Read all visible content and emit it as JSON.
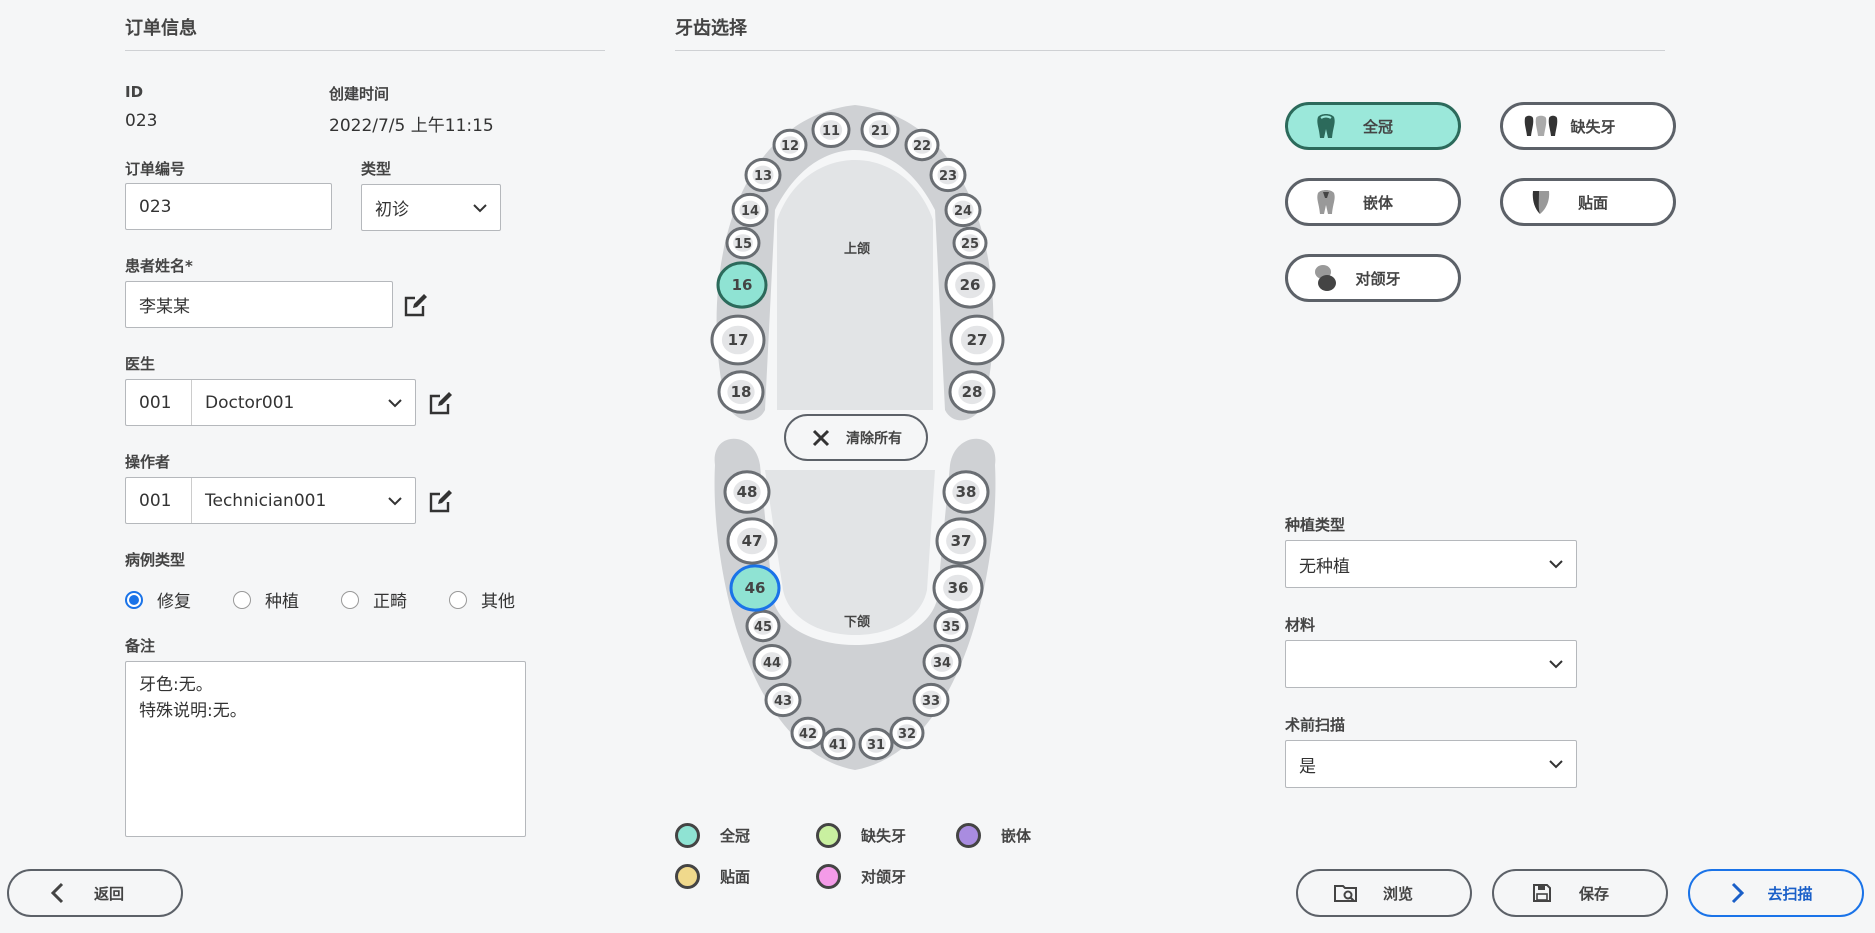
{
  "order": {
    "title": "订单信息",
    "id_label": "ID",
    "id_value": "023",
    "created_label": "创建时间",
    "created_value": "2022/7/5 上午11:15",
    "order_no_label": "订单编号",
    "order_no_value": "023",
    "type_label": "类型",
    "type_value": "初诊",
    "patient_label": "患者姓名*",
    "patient_value": "李某某",
    "doctor_label": "医生",
    "doctor_code": "001",
    "doctor_name": "Doctor001",
    "operator_label": "操作者",
    "operator_code": "001",
    "operator_name": "Technician001",
    "case_type_label": "病例类型",
    "case_types": [
      "修复",
      "种植",
      "正畸",
      "其他"
    ],
    "case_type_selected": "修复",
    "notes_label": "备注",
    "notes_value": "牙色:无。\n特殊说明:无。"
  },
  "teeth": {
    "title": "牙齿选择",
    "upper_label": "上颌",
    "lower_label": "下颌",
    "clear_label": "清除所有",
    "selected_full_crown": [
      "16",
      "46"
    ],
    "upper": [
      "11",
      "12",
      "13",
      "14",
      "15",
      "16",
      "17",
      "18",
      "21",
      "22",
      "23",
      "24",
      "25",
      "26",
      "27",
      "28"
    ],
    "lower": [
      "31",
      "32",
      "33",
      "34",
      "35",
      "36",
      "37",
      "38",
      "41",
      "42",
      "43",
      "44",
      "45",
      "46",
      "47",
      "48"
    ]
  },
  "restoration": {
    "buttons": [
      {
        "label": "全冠",
        "icon": "crown-icon",
        "active": true
      },
      {
        "label": "缺失牙",
        "icon": "missing-tooth-icon",
        "active": false
      },
      {
        "label": "嵌体",
        "icon": "inlay-icon",
        "active": false
      },
      {
        "label": "贴面",
        "icon": "veneer-icon",
        "active": false
      },
      {
        "label": "对颌牙",
        "icon": "antagonist-icon",
        "active": false
      }
    ]
  },
  "implant": {
    "type_label": "种植类型",
    "type_value": "无种植",
    "material_label": "材料",
    "material_value": "",
    "prescan_label": "术前扫描",
    "prescan_value": "是"
  },
  "legend": [
    {
      "label": "全冠",
      "color": "#8fe3d3"
    },
    {
      "label": "缺失牙",
      "color": "#c9f0a0"
    },
    {
      "label": "嵌体",
      "color": "#a98ce0"
    },
    {
      "label": "贴面",
      "color": "#f0d98c"
    },
    {
      "label": "对颌牙",
      "color": "#f49be8"
    }
  ],
  "footer": {
    "back_label": "返回",
    "browse_label": "浏览",
    "save_label": "保存",
    "scan_label": "去扫描"
  },
  "colors": {
    "accent": "#1a73e8",
    "full_crown": "#8fe3d3",
    "full_crown_border": "#2c6a5b"
  }
}
